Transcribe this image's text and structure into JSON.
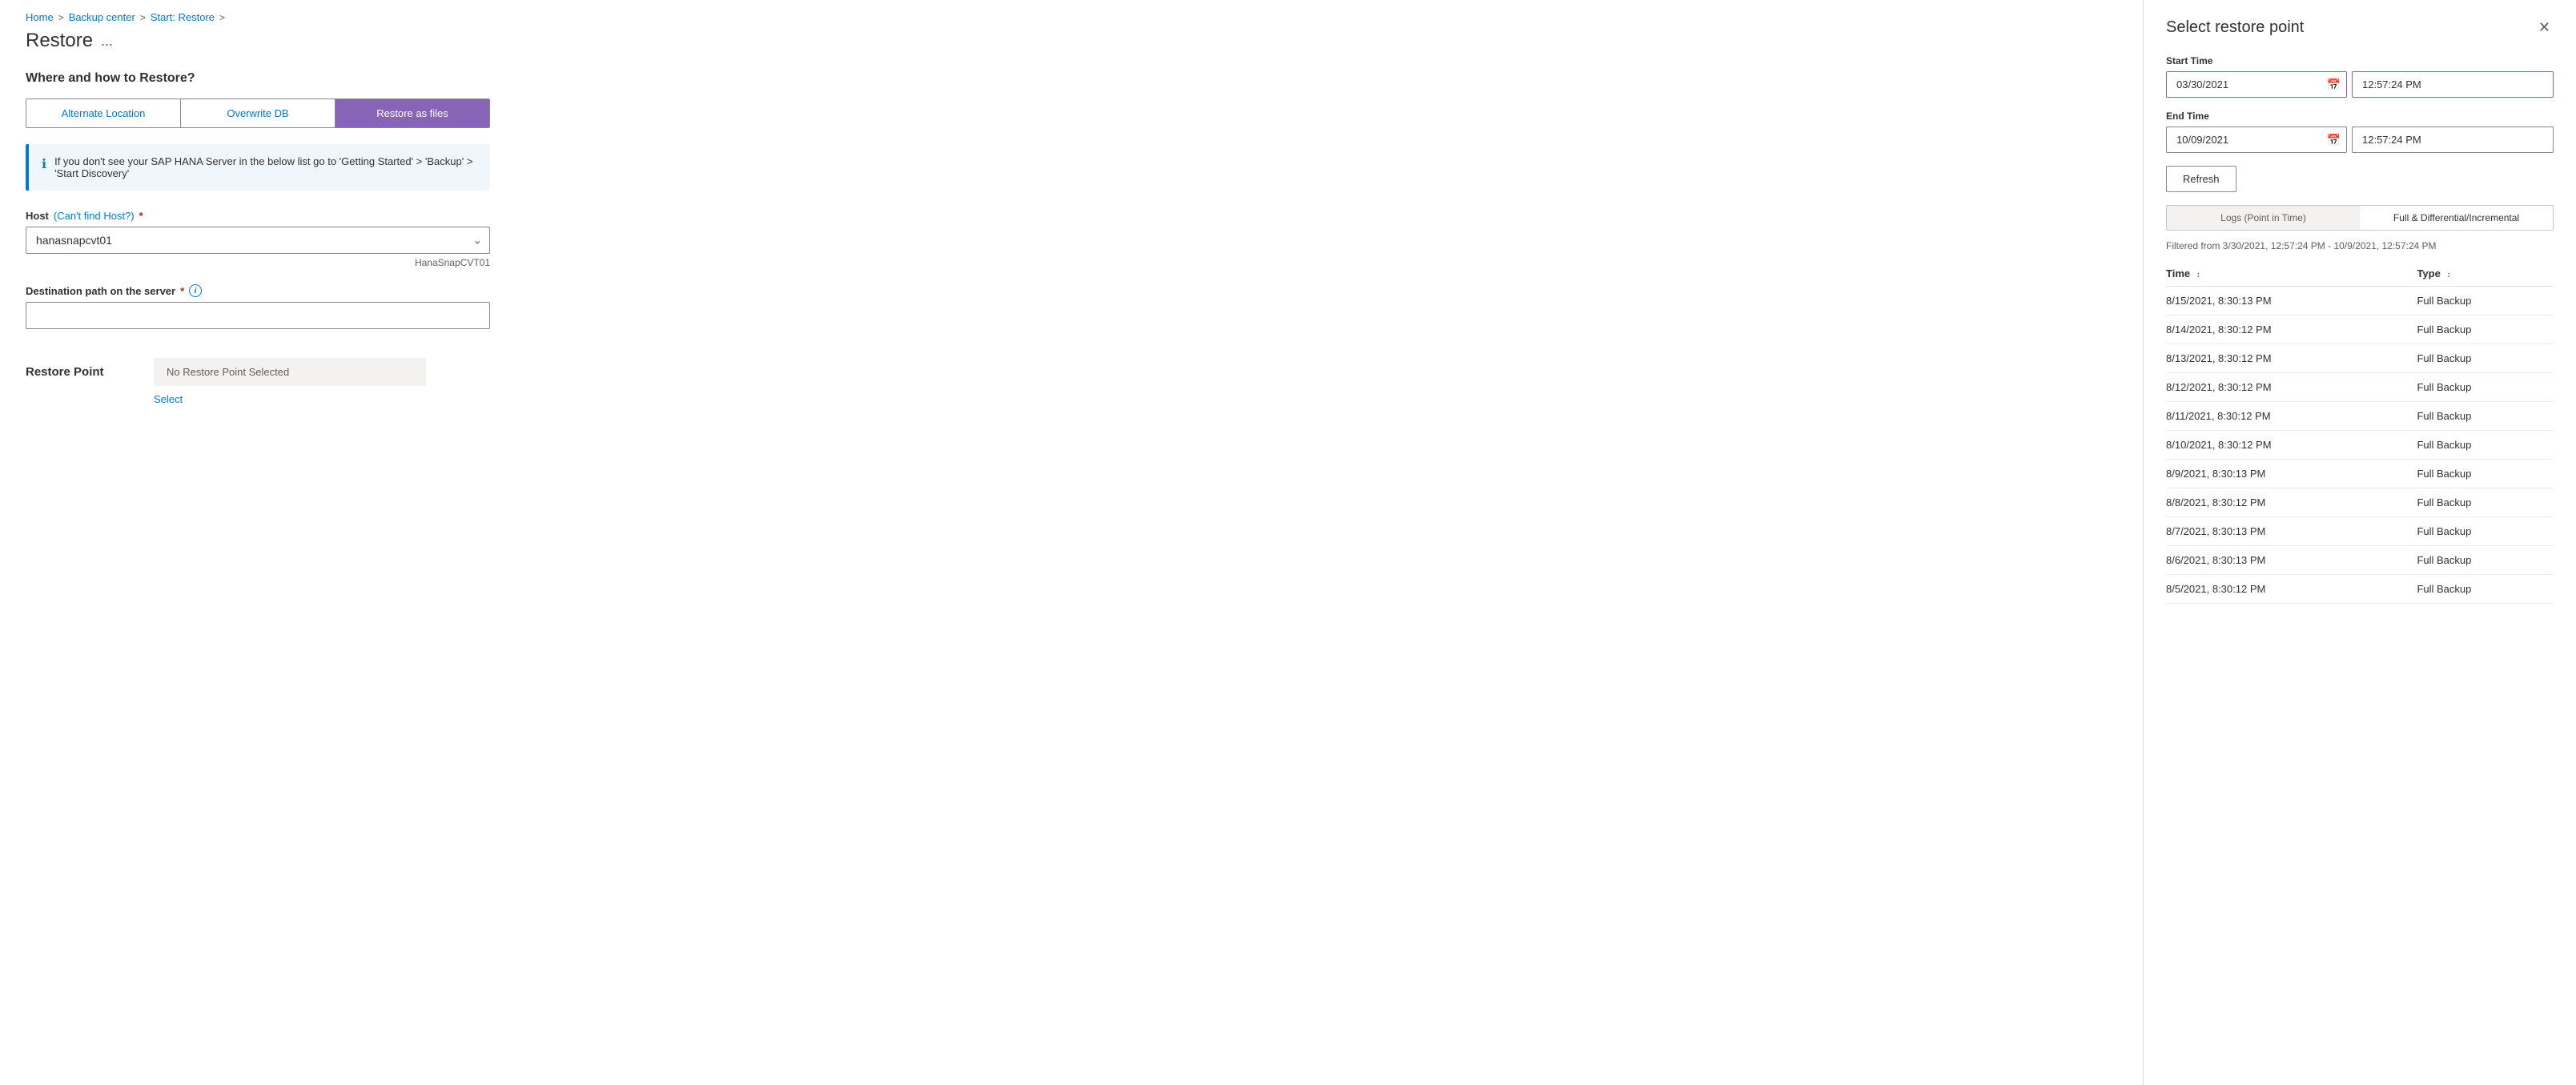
{
  "breadcrumb": {
    "home": "Home",
    "backup_center": "Backup center",
    "start_restore": "Start: Restore",
    "sep": ">"
  },
  "page": {
    "title": "Restore",
    "ellipsis": "...",
    "section_title": "Where and how to Restore?"
  },
  "tabs": {
    "alternate_location": "Alternate Location",
    "overwrite_db": "Overwrite DB",
    "restore_as_files": "Restore as files"
  },
  "info_box": {
    "text": "If you don't see your SAP HANA Server in the below list go to 'Getting Started' > 'Backup' > 'Start Discovery'"
  },
  "host_field": {
    "label": "Host",
    "cant_find": "(Can't find Host?)",
    "value": "hanasnapcvt01",
    "hint": "HanaSnapCVT01"
  },
  "destination_field": {
    "label": "Destination path on the server",
    "value": "",
    "tooltip": "i"
  },
  "restore_point": {
    "label": "Restore Point",
    "no_point": "No Restore Point Selected",
    "select_link": "Select"
  },
  "panel": {
    "title": "Select restore point",
    "close": "✕",
    "start_time_label": "Start Time",
    "end_time_label": "End Time",
    "start_date": "03/30/2021",
    "start_time": "12:57:24 PM",
    "end_date": "10/09/2021",
    "end_time": "12:57:24 PM",
    "refresh_label": "Refresh",
    "toggle_logs": "Logs (Point in Time)",
    "toggle_full": "Full & Differential/Incremental",
    "filter_text": "Filtered from 3/30/2021, 12:57:24 PM - 10/9/2021, 12:57:24 PM",
    "col_time": "Time",
    "col_type": "Type",
    "rows": [
      {
        "time": "8/15/2021, 8:30:13 PM",
        "type": "Full Backup"
      },
      {
        "time": "8/14/2021, 8:30:12 PM",
        "type": "Full Backup"
      },
      {
        "time": "8/13/2021, 8:30:12 PM",
        "type": "Full Backup"
      },
      {
        "time": "8/12/2021, 8:30:12 PM",
        "type": "Full Backup"
      },
      {
        "time": "8/11/2021, 8:30:12 PM",
        "type": "Full Backup"
      },
      {
        "time": "8/10/2021, 8:30:12 PM",
        "type": "Full Backup"
      },
      {
        "time": "8/9/2021, 8:30:13 PM",
        "type": "Full Backup"
      },
      {
        "time": "8/8/2021, 8:30:12 PM",
        "type": "Full Backup"
      },
      {
        "time": "8/7/2021, 8:30:13 PM",
        "type": "Full Backup"
      },
      {
        "time": "8/6/2021, 8:30:13 PM",
        "type": "Full Backup"
      },
      {
        "time": "8/5/2021, 8:30:12 PM",
        "type": "Full Backup"
      }
    ]
  }
}
